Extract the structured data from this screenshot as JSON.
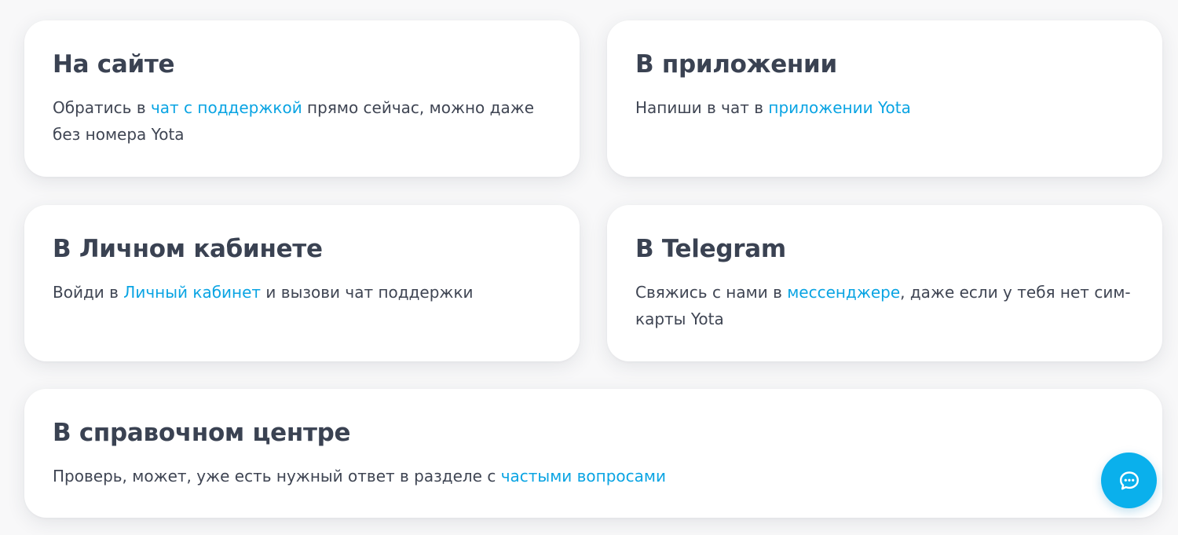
{
  "cards": {
    "site": {
      "title": "На сайте",
      "text_before": "Обратись в ",
      "link": "чат с поддержкой",
      "text_after": " прямо сейчас, можно даже без номера Yota"
    },
    "app": {
      "title": "В приложении",
      "text_before": "Напиши в чат в ",
      "link": "приложении Yota",
      "text_after": ""
    },
    "cabinet": {
      "title": "В Личном кабинете",
      "text_before": "Войди в ",
      "link": "Личный кабинет",
      "text_after": " и вызови чат поддержки"
    },
    "telegram": {
      "title": "В Telegram",
      "text_before": "Свяжись с нами в ",
      "link": "мессенджере",
      "text_after": ", даже если у тебя нет сим-карты Yota"
    },
    "help": {
      "title": "В справочном центре",
      "text_before": "Проверь, может, уже есть нужный ответ в разделе с ",
      "link": "частыми вопросами",
      "text_after": ""
    }
  },
  "chat_button": {
    "icon": "chat-bubble-icon"
  },
  "colors": {
    "heading": "#3a4252",
    "body_text": "#3f4553",
    "link": "#0aa4e3",
    "accent": "#0ab0ec",
    "card_bg": "#ffffff",
    "page_bg": "#f8f8f9"
  }
}
